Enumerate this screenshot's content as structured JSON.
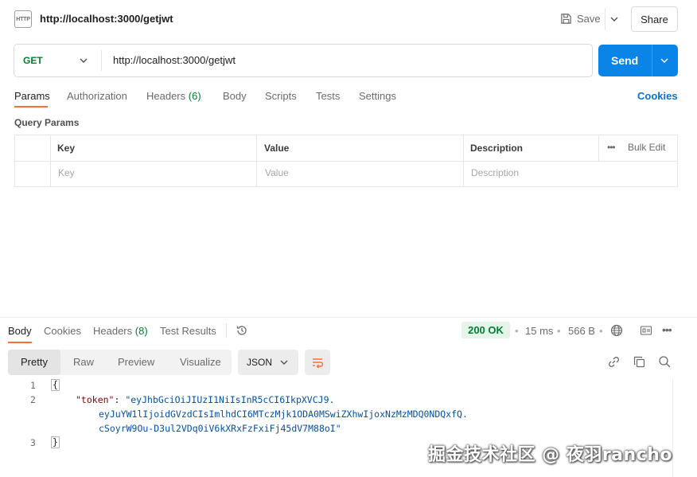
{
  "request": {
    "badge": "HTTP",
    "title": "http://localhost:3000/getjwt",
    "save_label": "Save",
    "share_label": "Share",
    "method": "GET",
    "url": "http://localhost:3000/getjwt",
    "send_label": "Send"
  },
  "request_tabs": {
    "params": "Params",
    "authorization": "Authorization",
    "headers": "Headers",
    "headers_count": "(6)",
    "body": "Body",
    "scripts": "Scripts",
    "tests": "Tests",
    "settings": "Settings",
    "cookies": "Cookies"
  },
  "query_params": {
    "title": "Query Params",
    "columns": [
      "Key",
      "Value",
      "Description"
    ],
    "placeholders": [
      "Key",
      "Value",
      "Description"
    ],
    "bulk_edit": "Bulk Edit",
    "more_dots": "•••"
  },
  "response_tabs": {
    "body": "Body",
    "cookies": "Cookies",
    "headers": "Headers",
    "headers_count": "(8)",
    "test_results": "Test Results"
  },
  "response_meta": {
    "status": "200 OK",
    "time": "15 ms",
    "size": "566 B",
    "dot": "•",
    "more": "•••"
  },
  "view_modes": {
    "pretty": "Pretty",
    "raw": "Raw",
    "preview": "Preview",
    "visualize": "Visualize",
    "format": "JSON"
  },
  "code": {
    "line_numbers": [
      "1",
      "2",
      "3"
    ],
    "open_brace": "{",
    "close_brace": "}",
    "key": "\"token\"",
    "colon": ": ",
    "value_line1": "\"eyJhbGciOiJIUzI1NiIsInR5cCI6IkpXVCJ9.",
    "value_line2": "eyJuYW1lIjoidGVzdCIsImlhdCI6MTczMjk1ODA0MSwiZXhwIjoxNzMzMDQ0NDQxfQ.",
    "value_line3": "cSoyrW9Ou-D3ul2VDq0iV6kXRxFzFxiFj45dV7M88oI\""
  },
  "watermark": "掘金技术社区 @ 夜羽rancho",
  "colors": {
    "accent": "#ff6c37",
    "send": "#0a84e6",
    "method_get": "#007f31",
    "status_ok_bg": "#e5f5ea",
    "json_string": "#0451a5",
    "json_key": "#800000"
  }
}
